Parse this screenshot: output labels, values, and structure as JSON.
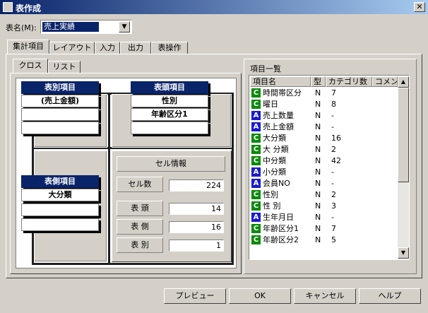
{
  "window": {
    "title": "表作成"
  },
  "table_name": {
    "label": "表名(M):",
    "value": "売上実績"
  },
  "tabs": [
    {
      "label": "集計項目"
    },
    {
      "label": "レイアウト"
    },
    {
      "label": "入力"
    },
    {
      "label": "出力"
    },
    {
      "label": "表操作"
    }
  ],
  "subtabs": [
    {
      "label": "クロス"
    },
    {
      "label": "リスト"
    }
  ],
  "cross": {
    "hyobetsu": {
      "title": "表別項目",
      "items": [
        "(売上金額)",
        "",
        ""
      ]
    },
    "hyoto": {
      "title": "表頭項目",
      "items": [
        "性別",
        "年齢区分1",
        ""
      ]
    },
    "hyosoku": {
      "title": "表側項目",
      "items": [
        "大分類",
        "",
        ""
      ]
    }
  },
  "cell_info": {
    "title": "セル情報",
    "rows": [
      {
        "label": "セル数",
        "value": "224"
      },
      {
        "label": "表 頭",
        "value": "14"
      },
      {
        "label": "表 側",
        "value": "16"
      },
      {
        "label": "表 別",
        "value": "1"
      }
    ]
  },
  "item_list": {
    "title": "項目一覧",
    "columns": [
      "項目名",
      "型",
      "カテゴリ数",
      "コメン"
    ],
    "rows": [
      {
        "icon": "C",
        "name": "時間帯区分",
        "type": "N",
        "count": "7"
      },
      {
        "icon": "C",
        "name": "曜日",
        "type": "N",
        "count": "8"
      },
      {
        "icon": "A",
        "name": "売上数量",
        "type": "N",
        "count": "-"
      },
      {
        "icon": "A",
        "name": "売上金額",
        "type": "N",
        "count": "-"
      },
      {
        "icon": "C",
        "name": "大分類",
        "type": "N",
        "count": "16"
      },
      {
        "icon": "C",
        "name": "大 分類",
        "type": "N",
        "count": "2"
      },
      {
        "icon": "C",
        "name": "中分類",
        "type": "N",
        "count": "42"
      },
      {
        "icon": "A",
        "name": "小分類",
        "type": "N",
        "count": "-"
      },
      {
        "icon": "A",
        "name": "会員NO",
        "type": "N",
        "count": "-"
      },
      {
        "icon": "C",
        "name": "性別",
        "type": "N",
        "count": "2"
      },
      {
        "icon": "C",
        "name": "性 別",
        "type": "N",
        "count": "3"
      },
      {
        "icon": "A",
        "name": "生年月日",
        "type": "N",
        "count": "-"
      },
      {
        "icon": "C",
        "name": "年齢区分1",
        "type": "N",
        "count": "7"
      },
      {
        "icon": "C",
        "name": "年齢区分2",
        "type": "N",
        "count": "5"
      }
    ]
  },
  "buttons": {
    "preview": "プレビュー",
    "ok": "OK",
    "cancel": "キャンセル",
    "help": "ヘルプ"
  },
  "icons": {
    "close": "close-icon",
    "dropdown": "chevron-down-icon",
    "scroll_up": "arrow-up-icon",
    "scroll_down": "arrow-down-icon"
  },
  "colors": {
    "titlebar": "#0a246a",
    "category_badge": "#0a8a0a",
    "numeric_badge": "#1a1ad0"
  }
}
